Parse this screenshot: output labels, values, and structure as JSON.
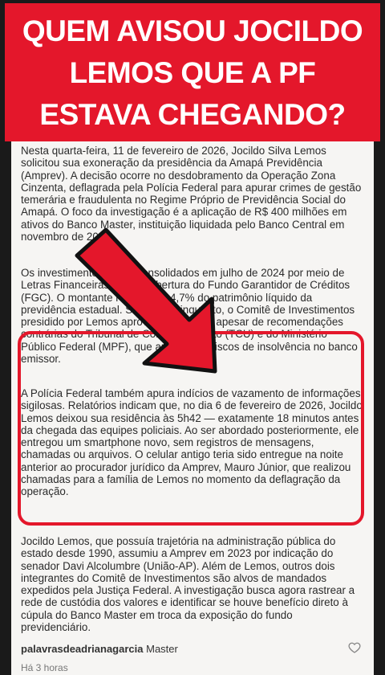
{
  "banner": {
    "line1": "QUEM AVISOU JOCILDO",
    "line2": "LEMOS QUE A PF",
    "line3": "ESTAVA CHEGANDO?"
  },
  "article": {
    "p1": "Nesta quarta-feira, 11 de fevereiro de 2026, Jocildo Silva Lemos solicitou sua exoneração da presidência da Amapá Previdência (Amprev). A decisão ocorre no desdobramento da Operação Zona Cinzenta, deflagrada pela Polícia Federal para apurar crimes de gestão temerária e fraudulenta no Regime Próprio de Previdência Social do Amapá. O foco da investigação é a aplicação de R$ 400 milhões em ativos do Banco Master, instituição liquidada pelo Banco Central em novembro de 2025.",
    "p2": "Os investimentos foram consolidados em julho de 2024 por meio de Letras Financeiras sem a cobertura do Fundo Garantidor de Créditos (FGC). O montante representa 4,7% do patrimônio líquido da previdência estadual. Segundo o inquérito, o Comitê de Investimentos presidido por Lemos aprovou os aportes apesar de recomendações contrárias do Tribunal de Contas da União (TCU) e do Ministério Público Federal (MPF), que apontavam riscos de insolvência no banco emissor.",
    "p3": "A Polícia Federal também apura indícios de vazamento de informações sigilosas. Relatórios indicam que, no dia 6 de fevereiro de 2026, Jocildo Lemos deixou sua residência às 5h42 — exatamente 18 minutos antes da chegada das equipes policiais. Ao ser abordado posteriormente, ele entregou um smartphone novo, sem registros de mensagens, chamadas ou arquivos. O celular antigo teria sido entregue na noite anterior ao procurador jurídico da Amprev, Mauro Júnior, que realizou chamadas para a família de Lemos no momento da deflagração da operação.",
    "p4": "Jocildo Lemos, que possuía trajetória na administração pública do estado desde 1990, assumiu a Amprev em 2023 por indicação do senador Davi Alcolumbre (União-AP). Além de Lemos, outros dois integrantes do Comitê de Investimentos são alvos de mandados expedidos pela Justiça Federal. A investigação busca agora rastrear a rede de custódia dos valores e identificar se houve benefício direto à cúpula do Banco Master em troca da exposição do fundo previdenciário."
  },
  "footer": {
    "username": "palavrasdeadrianagarcia",
    "caption": "Master",
    "time": "Há 3 horas",
    "like_icon": "heart-icon"
  },
  "colors": {
    "accent": "#e4172b",
    "text": "#2b2b2b"
  }
}
